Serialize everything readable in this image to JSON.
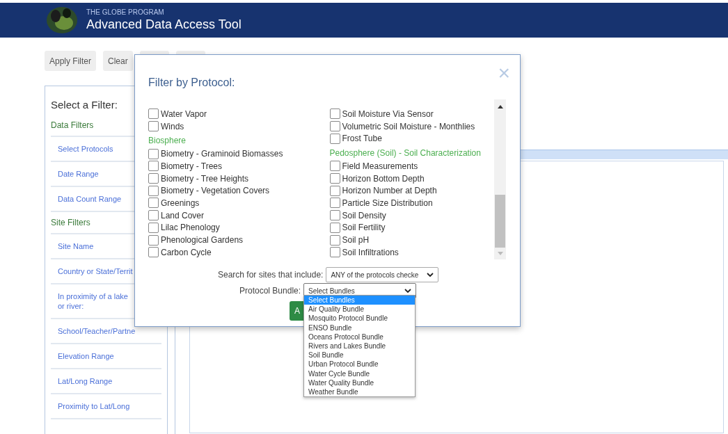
{
  "header": {
    "org": "THE GLOBE PROGRAM",
    "title": "Advanced Data Access Tool"
  },
  "toolbar": [
    {
      "label": "Apply Filter"
    },
    {
      "label": "Clear"
    }
  ],
  "sidebar": {
    "title": "Select a Filter:",
    "groups": [
      {
        "heading": "Data Filters",
        "items": [
          "Select Protocols",
          "Date Range",
          "Data Count Range"
        ]
      },
      {
        "heading": "Site Filters",
        "items": [
          "Site Name",
          "Country or State/Territ",
          "In proximity of a lake or river:",
          "School/Teacher/Partne",
          "Elevation Range",
          "Lat/Long Range",
          "Proximity to Lat/Long"
        ]
      }
    ]
  },
  "modal": {
    "title": "Filter by Protocol:",
    "close": "×",
    "columns": [
      [
        {
          "kind": "item",
          "label": "Water Vapor",
          "checked": false
        },
        {
          "kind": "item",
          "label": "Winds",
          "checked": false
        },
        {
          "kind": "heading",
          "label": "Biosphere"
        },
        {
          "kind": "item",
          "label": "Biometry - Graminoid Biomasses",
          "checked": false
        },
        {
          "kind": "item",
          "label": "Biometry - Trees",
          "checked": false
        },
        {
          "kind": "item",
          "label": "Biometry - Tree Heights",
          "checked": false
        },
        {
          "kind": "item",
          "label": "Biometry - Vegetation Covers",
          "checked": false
        },
        {
          "kind": "item",
          "label": "Greenings",
          "checked": false
        },
        {
          "kind": "item",
          "label": "Land Cover",
          "checked": false
        },
        {
          "kind": "item",
          "label": "Lilac Phenology",
          "checked": false
        },
        {
          "kind": "item",
          "label": "Phenological Gardens",
          "checked": false
        },
        {
          "kind": "item",
          "label": "Carbon Cycle",
          "checked": false
        }
      ],
      [
        {
          "kind": "item",
          "label": "Soil Moisture Via Sensor",
          "checked": false
        },
        {
          "kind": "item",
          "label": "Volumetric Soil Moisture - Monthlies",
          "checked": false
        },
        {
          "kind": "item",
          "label": "Frost Tube",
          "checked": false
        },
        {
          "kind": "heading",
          "label": "Pedosphere (Soil) - Soil Characterization"
        },
        {
          "kind": "item",
          "label": "Field Measurements",
          "checked": false
        },
        {
          "kind": "item",
          "label": "Horizon Bottom Depth",
          "checked": false
        },
        {
          "kind": "item",
          "label": "Horizon Number at Depth",
          "checked": false
        },
        {
          "kind": "item",
          "label": "Particle Size Distribution",
          "checked": false
        },
        {
          "kind": "item",
          "label": "Soil Density",
          "checked": false
        },
        {
          "kind": "item",
          "label": "Soil Fertility",
          "checked": false
        },
        {
          "kind": "item",
          "label": "Soil pH",
          "checked": false
        },
        {
          "kind": "item",
          "label": "Soil Infiltrations",
          "checked": false
        }
      ]
    ],
    "search_label": "Search for sites that include:",
    "search_value": "ANY of the protocols checke",
    "bundle_label": "Protocol Bundle:",
    "bundle_value": "Select Bundles",
    "apply_button": "A",
    "bundle_options": [
      {
        "label": "Select Bundles",
        "selected": true
      },
      {
        "label": "Air Quality Bundle",
        "selected": false
      },
      {
        "label": "Mosquito Protocol Bundle",
        "selected": false
      },
      {
        "label": "ENSO Bundle",
        "selected": false
      },
      {
        "label": "Oceans Protocol Bundle",
        "selected": false
      },
      {
        "label": "Rivers and Lakes Bundle",
        "selected": false
      },
      {
        "label": "Soil Bundle",
        "selected": false
      },
      {
        "label": "Urban Protocol Bundle",
        "selected": false
      },
      {
        "label": "Water Cycle Bundle",
        "selected": false
      },
      {
        "label": "Water Quality Bundle",
        "selected": false
      },
      {
        "label": "Weather Bundle",
        "selected": false
      }
    ]
  }
}
